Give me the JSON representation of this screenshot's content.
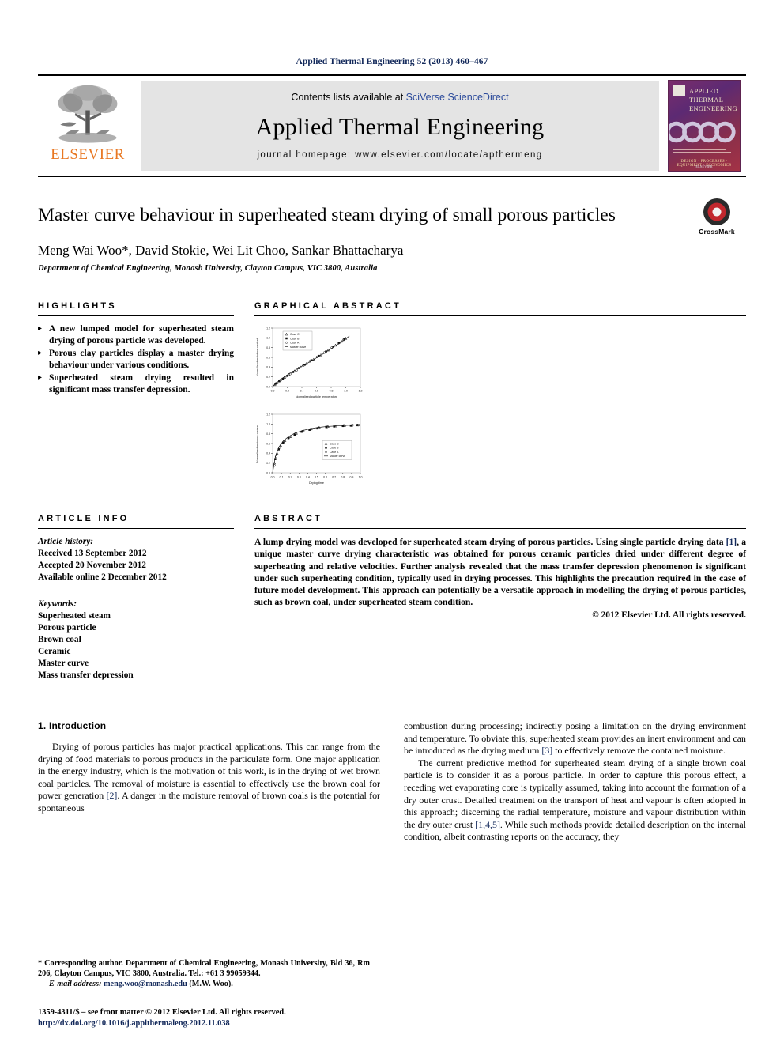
{
  "running_head": "Applied Thermal Engineering 52 (2013) 460–467",
  "masthead": {
    "publisher": "ELSEVIER",
    "contents_prefix": "Contents lists available at ",
    "contents_link": "SciVerse ScienceDirect",
    "journal_name": "Applied Thermal Engineering",
    "homepage": "journal homepage: www.elsevier.com/locate/apthermeng",
    "cover": {
      "title_line1": "APPLIED",
      "title_line2": "THERMAL",
      "title_line3": "ENGINEERING",
      "keywords": "DESIGN  ·  PROCESSES  ·  EQUIPMENT  ·  ECONOMICS",
      "publisher_foot": "ELSEVIER"
    }
  },
  "article": {
    "title": "Master curve behaviour in superheated steam drying of small porous particles",
    "authors": "Meng Wai Woo*, David Stokie, Wei Lit Choo, Sankar Bhattacharya",
    "affiliation": "Department of Chemical Engineering, Monash University, Clayton Campus, VIC 3800, Australia",
    "crossmark_label": "CrossMark"
  },
  "highlights": {
    "heading": "HIGHLIGHTS",
    "items": [
      "A new lumped model for superheated steam drying of porous particle was developed.",
      "Porous clay particles display a master drying behaviour under various conditions.",
      "Superheated steam drying resulted in significant mass transfer depression."
    ]
  },
  "graphical_abstract": {
    "heading": "GRAPHICAL ABSTRACT"
  },
  "article_info": {
    "heading": "ARTICLE INFO",
    "history_label": "Article history:",
    "history": [
      "Received 13 September 2012",
      "Accepted 20 November 2012",
      "Available online 2 December 2012"
    ],
    "keywords_label": "Keywords:",
    "keywords": [
      "Superheated steam",
      "Porous particle",
      "Brown coal",
      "Ceramic",
      "Master curve",
      "Mass transfer depression"
    ]
  },
  "abstract": {
    "heading": "ABSTRACT",
    "part1": "A lump drying model was developed for superheated steam drying of porous particles. Using single particle drying data ",
    "ref1": "[1]",
    "part2": ", a unique master curve drying characteristic was obtained for porous ceramic particles dried under different degree of superheating and relative velocities. Further analysis revealed that the mass transfer depression phenomenon is significant under such superheating condition, typically used in drying processes. This highlights the precaution required in the case of future model development. This approach can potentially be a versatile approach in modelling the drying of porous particles, such as brown coal, under superheated steam condition.",
    "copyright": "© 2012 Elsevier Ltd. All rights reserved."
  },
  "body": {
    "section_heading": "1.  Introduction",
    "left_p1_a": "Drying of porous particles has major practical applications. This can range from the drying of food materials to porous products in the particulate form. One major application in the energy industry, which is the motivation of this work, is in the drying of wet brown coal particles. The removal of moisture is essential to effectively use the brown coal for power generation ",
    "left_ref1": "[2]",
    "left_p1_b": ". A danger in the moisture removal of brown coals is the potential for spontaneous",
    "right_p1_a": "combustion during processing; indirectly posing a limitation on the drying environment and temperature. To obviate this, superheated steam provides an inert environment and can be introduced as the drying medium ",
    "right_ref1": "[3]",
    "right_p1_b": " to effectively remove the contained moisture.",
    "right_p2_a": "The current predictive method for superheated steam drying of a single brown coal particle is to consider it as a porous particle. In order to capture this porous effect, a receding wet evaporating core is typically assumed, taking into account the formation of a dry outer crust. Detailed treatment on the transport of heat and vapour is often adopted in this approach; discerning the radial temperature, moisture and vapour distribution within the dry outer crust ",
    "right_ref2": "[1,4,5]",
    "right_p2_b": ". While such methods provide detailed description on the internal condition, albeit contrasting reports on the accuracy, they"
  },
  "footnotes": {
    "corresponding_a": "* Corresponding author. Department of Chemical Engineering, Monash University, Bld 36, Rm 206, Clayton Campus, VIC 3800, Australia. Tel.: +61 3 99059344.",
    "email_label": "E-mail address:",
    "email": "meng.woo@monash.edu",
    "email_suffix": "(M.W. Woo).",
    "issn": "1359-4311/$ – see front matter © 2012 Elsevier Ltd. All rights reserved.",
    "doi": "http://dx.doi.org/10.1016/j.applthermaleng.2012.11.038"
  },
  "chart_data": [
    {
      "type": "scatter",
      "title": "",
      "xlabel": "Normalised particle temperature",
      "ylabel": "Normalised moisture content",
      "xlim": [
        0,
        1.2
      ],
      "ylim": [
        0,
        1.2
      ],
      "xticks": [
        "0.0",
        "0.2",
        "0.4",
        "0.6",
        "0.8",
        "1.0",
        "1.2"
      ],
      "yticks": [
        "0.0",
        "0.2",
        "0.4",
        "0.6",
        "0.8",
        "1.0",
        "1.2"
      ],
      "grid": false,
      "legend_position": "top-left",
      "series": [
        {
          "name": "Case C",
          "marker": "triangle",
          "x": [
            0.03,
            0.06,
            0.1,
            0.16,
            0.22,
            0.3,
            0.38,
            0.46,
            0.56,
            0.66,
            0.76,
            0.86,
            0.94,
            1.0
          ],
          "y": [
            0.04,
            0.08,
            0.13,
            0.19,
            0.25,
            0.32,
            0.4,
            0.47,
            0.56,
            0.65,
            0.75,
            0.85,
            0.93,
            0.99
          ]
        },
        {
          "name": "Case B",
          "marker": "square",
          "x": [
            0.04,
            0.09,
            0.14,
            0.2,
            0.28,
            0.36,
            0.44,
            0.53,
            0.63,
            0.73,
            0.83,
            0.91,
            0.98
          ],
          "y": [
            0.06,
            0.11,
            0.16,
            0.22,
            0.3,
            0.38,
            0.45,
            0.54,
            0.63,
            0.72,
            0.82,
            0.9,
            0.97
          ]
        },
        {
          "name": "Case A",
          "marker": "circle",
          "x": [
            0.05,
            0.11,
            0.17,
            0.24,
            0.33,
            0.42,
            0.51,
            0.61,
            0.71,
            0.81,
            0.9,
            0.97
          ],
          "y": [
            0.07,
            0.13,
            0.19,
            0.26,
            0.34,
            0.43,
            0.52,
            0.61,
            0.7,
            0.8,
            0.89,
            0.96
          ]
        },
        {
          "name": "Master curve",
          "marker": "line",
          "x": [
            0.0,
            0.1,
            0.2,
            0.3,
            0.4,
            0.5,
            0.6,
            0.7,
            0.8,
            0.9,
            1.0,
            1.05
          ],
          "y": [
            0.0,
            0.14,
            0.24,
            0.33,
            0.42,
            0.5,
            0.59,
            0.68,
            0.78,
            0.88,
            0.98,
            1.04
          ]
        }
      ]
    },
    {
      "type": "scatter",
      "title": "",
      "xlabel": "Drying time",
      "ylabel": "Normalised moisture content",
      "xlim": [
        0,
        1.0
      ],
      "ylim": [
        0,
        1.2
      ],
      "xticks": [
        "0.0",
        "0.1",
        "0.2",
        "0.3",
        "0.4",
        "0.5",
        "0.6",
        "0.7",
        "0.8",
        "0.9",
        "1.0"
      ],
      "yticks": [
        "0.0",
        "0.2",
        "0.4",
        "0.6",
        "0.8",
        "1.0",
        "1.2"
      ],
      "grid": false,
      "legend_position": "middle-right",
      "series": [
        {
          "name": "Case C",
          "marker": "triangle",
          "x": [
            0.02,
            0.05,
            0.09,
            0.14,
            0.2,
            0.27,
            0.35,
            0.44,
            0.53,
            0.63,
            0.72,
            0.82,
            0.9,
            0.97
          ],
          "y": [
            0.2,
            0.4,
            0.56,
            0.66,
            0.74,
            0.81,
            0.86,
            0.9,
            0.93,
            0.95,
            0.96,
            0.97,
            0.97,
            0.98
          ]
        },
        {
          "name": "Case B",
          "marker": "square",
          "x": [
            0.03,
            0.07,
            0.12,
            0.18,
            0.25,
            0.33,
            0.42,
            0.51,
            0.61,
            0.7,
            0.8,
            0.89,
            0.96
          ],
          "y": [
            0.28,
            0.48,
            0.62,
            0.71,
            0.78,
            0.84,
            0.88,
            0.91,
            0.94,
            0.95,
            0.96,
            0.97,
            0.98
          ]
        },
        {
          "name": "Case A",
          "marker": "circle",
          "x": [
            0.02,
            0.04,
            0.08,
            0.13,
            0.19,
            0.26,
            0.34,
            0.43,
            0.52,
            0.62,
            0.71,
            0.81,
            0.91,
            0.98
          ],
          "y": [
            0.15,
            0.33,
            0.52,
            0.64,
            0.73,
            0.8,
            0.85,
            0.89,
            0.92,
            0.94,
            0.96,
            0.97,
            0.98,
            0.98
          ]
        },
        {
          "name": "Master curve",
          "marker": "line",
          "x": [
            0.0,
            0.03,
            0.07,
            0.12,
            0.18,
            0.25,
            0.33,
            0.42,
            0.52,
            0.62,
            0.72,
            0.82,
            0.92,
            1.0
          ],
          "y": [
            0.0,
            0.32,
            0.52,
            0.65,
            0.74,
            0.81,
            0.86,
            0.9,
            0.93,
            0.95,
            0.96,
            0.97,
            0.98,
            0.98
          ]
        }
      ]
    }
  ]
}
